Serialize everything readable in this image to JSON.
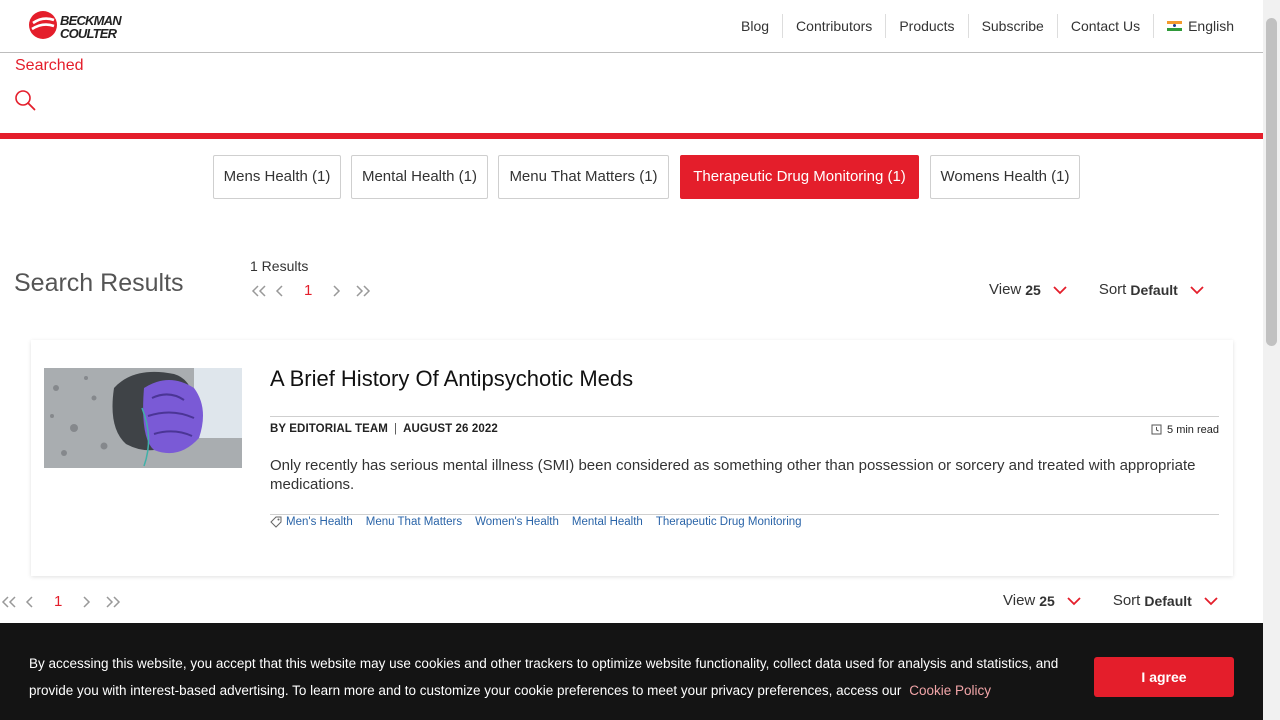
{
  "brand": {
    "line1": "BECKMAN",
    "line2": "COULTER"
  },
  "nav": {
    "items": [
      "Blog",
      "Contributors",
      "Products",
      "Subscribe",
      "Contact Us"
    ],
    "language": "English"
  },
  "search": {
    "label": "Searched"
  },
  "filters": {
    "pills": [
      "Mens Health (1)",
      "Mental Health (1)",
      "Menu That Matters (1)",
      "Therapeutic Drug Monitoring (1)",
      "Womens Health (1)"
    ],
    "active": "Therapeutic Drug Monitoring (1)"
  },
  "results": {
    "title": "Search Results",
    "count": "1 Results",
    "page": "1",
    "view_label": "View",
    "view_value": "25",
    "sort_label": "Sort",
    "sort_value": "Default"
  },
  "article": {
    "title": "A Brief History Of Antipsychotic Meds",
    "author": "BY EDITORIAL TEAM",
    "date": "AUGUST 26 2022",
    "readtime": "5 min read",
    "excerpt": "Only recently has serious mental illness (SMI) been considered as something other than possession or sorcery and treated with appropriate medications.",
    "tags": [
      "Men's Health",
      "Menu That Matters",
      "Women's Health",
      "Mental Health",
      "Therapeutic Drug Monitoring"
    ]
  },
  "cookie": {
    "text": "By accessing this website, you accept that this website may use cookies and other trackers to optimize website functionality, collect data used for analysis and statistics, and provide you with interest-based advertising. To learn more and to customize your cookie preferences to meet your privacy preferences, access our",
    "link": "Cookie Policy",
    "button": "I agree"
  },
  "colors": {
    "accent": "#e41e2b",
    "tag_link": "#2a64a8",
    "banner_bg": "#141414"
  },
  "icons": [
    "brand-logo-icon",
    "india-flag-icon",
    "search-icon",
    "first-page-icon",
    "prev-page-icon",
    "next-page-icon",
    "last-page-icon",
    "chevron-down-icon",
    "clock-icon",
    "tag-icon"
  ]
}
